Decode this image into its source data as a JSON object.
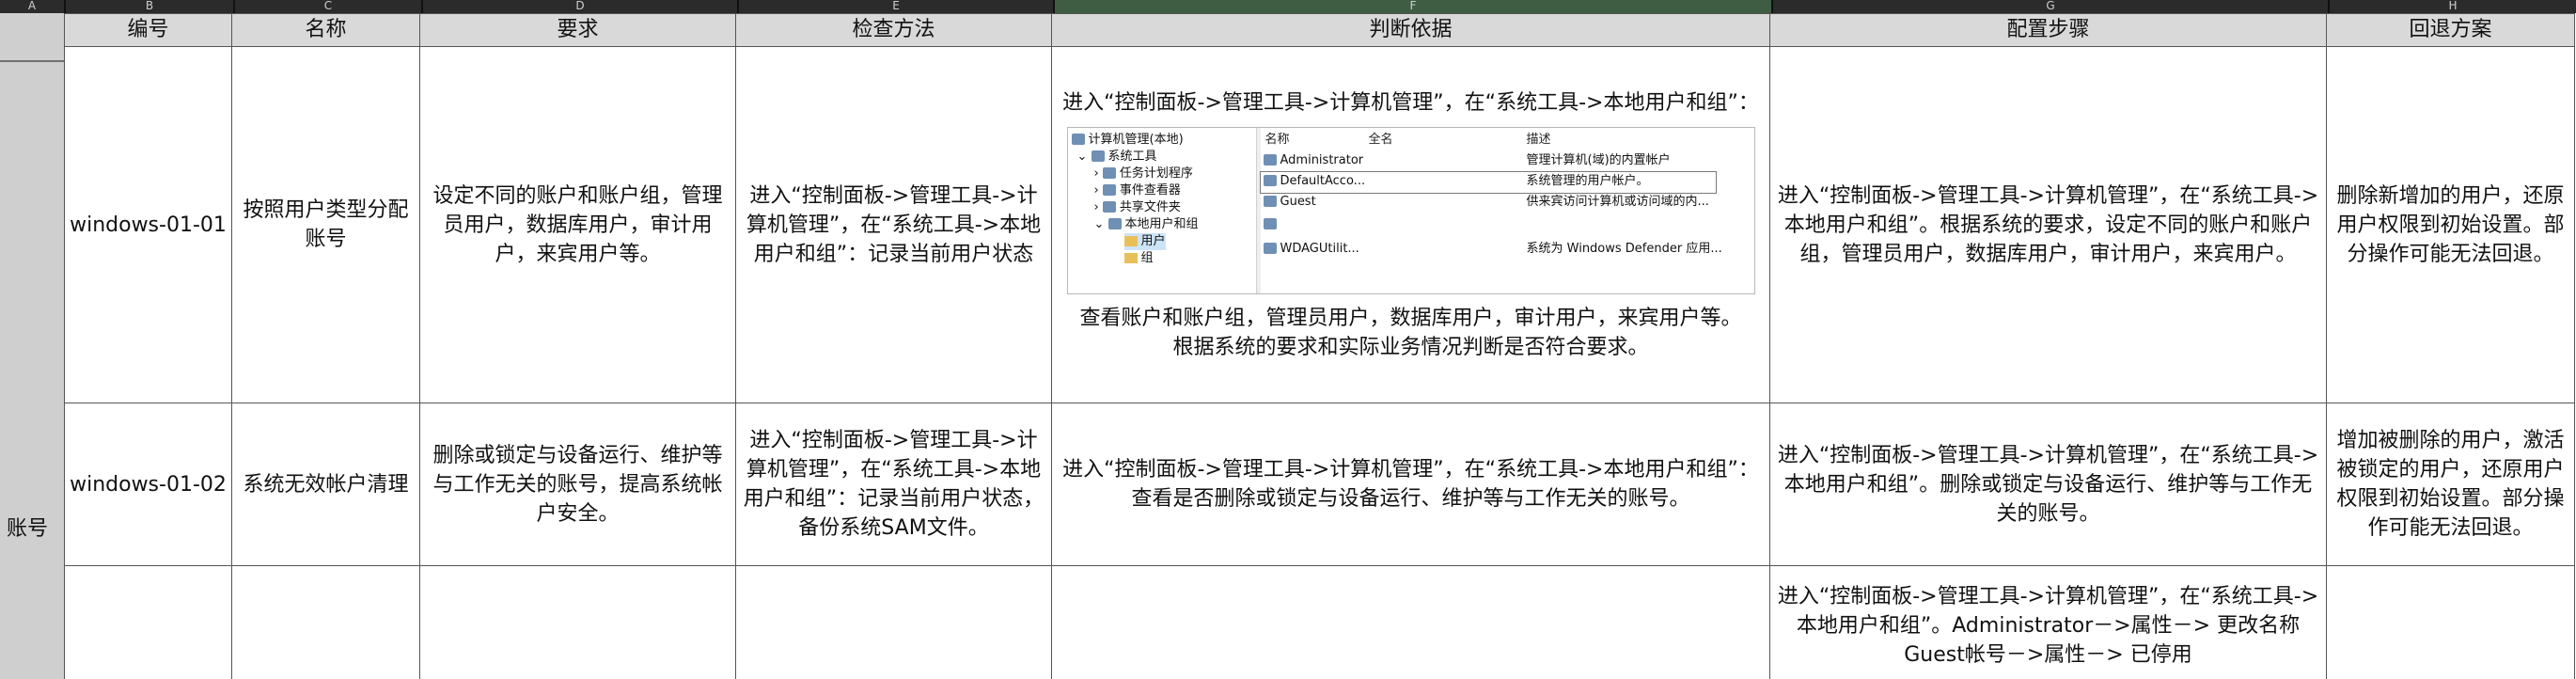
{
  "column_letters": [
    "A",
    "B",
    "C",
    "D",
    "E",
    "F",
    "G",
    "H"
  ],
  "header": {
    "num": "编号",
    "name": "名称",
    "req": "要求",
    "check": "检查方法",
    "judge": "判断依据",
    "steps": "配置步骤",
    "rollback": "回退方案"
  },
  "group_label": "账号",
  "rows": [
    {
      "num": "windows-01-01",
      "name": "按照用户类型分配账号",
      "req": "设定不同的账户和账户组，管理员用户，数据库用户，审计用户，来宾用户等。",
      "check": "进入“控制面板->管理工具->计算机管理”，在“系统工具->本地用户和组”：记录当前用户状态",
      "judge_top": "进入“控制面板->管理工具->计算机管理”，在“系统工具->本地用户和组”：",
      "judge_bottom1": "查看账户和账户组，管理员用户，数据库用户，审计用户，来宾用户等。",
      "judge_bottom2": "根据系统的要求和实际业务情况判断是否符合要求。",
      "steps": "进入“控制面板->管理工具->计算机管理”，在“系统工具->本地用户和组”。根据系统的要求，设定不同的账户和账户组，管理员用户，数据库用户，审计用户，来宾用户。",
      "rollback": "删除新增加的用户，还原用户权限到初始设置。部分操作可能无法回退。"
    },
    {
      "num": "windows-01-02",
      "name": "系统无效帐户清理",
      "req": "删除或锁定与设备运行、维护等与工作无关的账号，提高系统帐户安全。",
      "check": "进入“控制面板->管理工具->计算机管理”，在“系统工具->本地用户和组”：记录当前用户状态，备份系统SAM文件。",
      "judge": "进入“控制面板->管理工具->计算机管理”，在“系统工具->本地用户和组”：查看是否删除或锁定与设备运行、维护等与工作无关的账号。",
      "steps": "进入“控制面板->管理工具->计算机管理”，在“系统工具->本地用户和组”。删除或锁定与设备运行、维护等与工作无关的账号。",
      "rollback": "增加被删除的用户，激活被锁定的用户，还原用户权限到初始设置。部分操作可能无法回退。"
    },
    {
      "steps": "进入“控制面板->管理工具->计算机管理”，在“系统工具->本地用户和组”。Administrator－>属性－> 更改名称 Guest帐号－>属性－> 已停用"
    }
  ],
  "screenshot": {
    "tree": [
      "计算机管理(本地)",
      "系统工具",
      "任务计划程序",
      "事件查看器",
      "共享文件夹",
      "本地用户和组",
      "用户",
      "组"
    ],
    "cols": [
      "名称",
      "全名",
      "描述"
    ],
    "users": [
      {
        "name": "Administrator",
        "desc": "管理计算机(域)的内置帐户"
      },
      {
        "name": "DefaultAcco...",
        "desc": "系统管理的用户帐户。"
      },
      {
        "name": "Guest",
        "desc": "供来宾访问计算机或访问域的内..."
      },
      {
        "name": "",
        "desc": ""
      },
      {
        "name": "WDAGUtilit...",
        "desc": "系统为 Windows Defender 应用..."
      }
    ]
  }
}
